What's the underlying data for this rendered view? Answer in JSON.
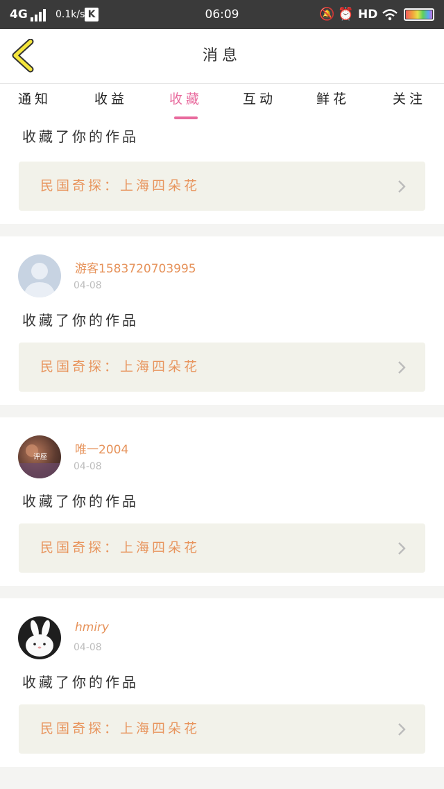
{
  "status_bar": {
    "network": "4G",
    "speed": "0.1k/s",
    "app_badge": "K",
    "time": "06:09",
    "hd": "HD"
  },
  "header": {
    "title": "消息"
  },
  "tabs": [
    {
      "label": "通知",
      "active": false
    },
    {
      "label": "收益",
      "active": false
    },
    {
      "label": "收藏",
      "active": true
    },
    {
      "label": "互动",
      "active": false
    },
    {
      "label": "鲜花",
      "active": false
    },
    {
      "label": "关注",
      "active": false
    }
  ],
  "accent_color": "#e86a9d",
  "link_color": "#e8955e",
  "notifications": [
    {
      "user": null,
      "date": null,
      "action": "收藏了你的作品",
      "work_title": "民国奇探：上海四朵花"
    },
    {
      "user": "游客1583720703995",
      "date": "04-08",
      "avatar": "default-avatar",
      "action": "收藏了你的作品",
      "work_title": "民国奇探：上海四朵花"
    },
    {
      "user": "唯一2004",
      "date": "04-08",
      "avatar": "photo-avatar",
      "avatar_caption": "评座",
      "action": "收藏了你的作品",
      "work_title": "民国奇探：上海四朵花"
    },
    {
      "user": "hmiry",
      "date": "04-08",
      "avatar": "bunny-avatar",
      "action": "收藏了你的作品",
      "work_title": "民国奇探：上海四朵花"
    }
  ]
}
